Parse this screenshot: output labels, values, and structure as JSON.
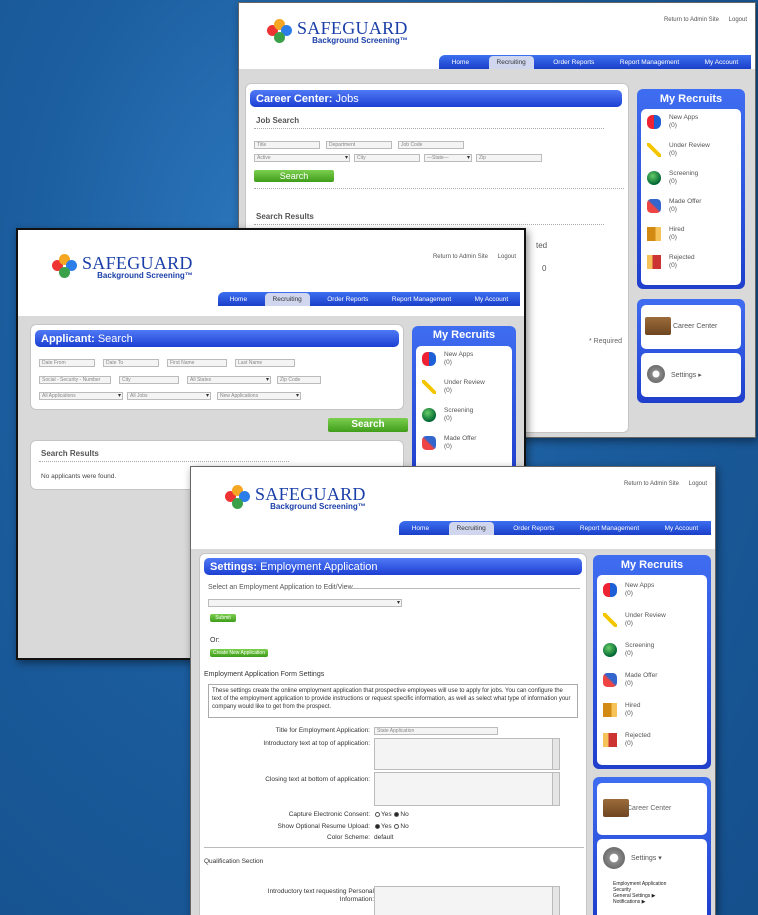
{
  "brand": {
    "name": "SAFEGUARD",
    "tagline": "Background Screening™"
  },
  "top_links": {
    "return": "Return to Admin Site",
    "logout": "Logout"
  },
  "nav": [
    "Home",
    "Recruiting",
    "Order Reports",
    "Report Management",
    "My Account"
  ],
  "recruits": {
    "title": "My Recruits",
    "items": [
      {
        "label": "New Apps",
        "count": "(0)",
        "icon": "new-apps-icon"
      },
      {
        "label": "Under Review",
        "count": "(0)",
        "icon": "pencil-icon"
      },
      {
        "label": "Screening",
        "count": "(0)",
        "icon": "globe-icon"
      },
      {
        "label": "Made Offer",
        "count": "(0)",
        "icon": "handshake-icon"
      },
      {
        "label": "Hired",
        "count": "(0)",
        "icon": "door-enter-icon"
      },
      {
        "label": "Rejected",
        "count": "(0)",
        "icon": "door-exit-icon"
      }
    ]
  },
  "side": {
    "career_center": "Career Center",
    "settings": "Settings ▸",
    "settings_open": "Settings ▾",
    "sub": [
      "Employment Application",
      "Security",
      "General Settings ▶",
      "Notifications ▶"
    ]
  },
  "win1": {
    "head_bold": "Career Center:",
    "head_rest": " Jobs",
    "job_search": "Job Search",
    "fields": {
      "title": "Title",
      "department": "Department",
      "job_code": "Job Code",
      "status": "Active",
      "city": "City",
      "state": "—State—",
      "zip": "Zip"
    },
    "search": "Search",
    "results": "Search Results",
    "required": "* Required",
    "partial1": "ted",
    "partial2": "0"
  },
  "win2": {
    "head_bold": "Applicant:",
    "head_rest": " Search",
    "fields": {
      "date_from": "Date From",
      "date_to": "Date To",
      "first": "First Name",
      "last": "Last Name",
      "ssn": "Social - Security - Number",
      "city": "City",
      "states": "All States",
      "zip": "Zip Code",
      "apps": "All Applications",
      "jobs": "All Jobs",
      "new_apps": "New Applications"
    },
    "search": "Search",
    "results": "Search Results",
    "none": "No applicants were found."
  },
  "win3": {
    "head_bold": "Settings:",
    "head_rest": " Employment Application",
    "select_legend": "Select an Employment Application to Edit/View",
    "submit": "Submit",
    "or": "Or:",
    "create": "Create New Application",
    "form_settings": "Employment Application Form Settings",
    "description": "These settings create the online employment application that prospective employees will use to apply for jobs. You can configure the text of the employment application to provide instructions or request specific information, as well as select what type of information your company would like to get from the prospect.",
    "title_label": "Title for Employment Application:",
    "title_value": "State Application",
    "intro_label": "Introductory text at top of application:",
    "closing_label": "Closing text at bottom of application:",
    "consent_label": "Capture Electronic Consent:",
    "resume_label": "Show Optional Resume Upload:",
    "yes": "Yes",
    "no": "No",
    "color_label": "Color Scheme:",
    "color_value": "default",
    "qual": "Qualification Section",
    "qual_intro": "Introductory text requesting Personal Information:"
  }
}
